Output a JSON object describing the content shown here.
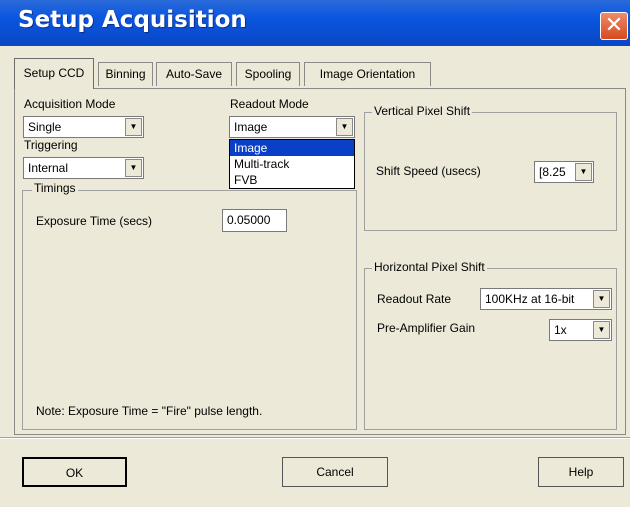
{
  "window": {
    "title": "Setup Acquisition",
    "close_glyph": "✕"
  },
  "tabs": [
    {
      "label": "Setup CCD",
      "active": true
    },
    {
      "label": "Binning"
    },
    {
      "label": "Auto-Save"
    },
    {
      "label": "Spooling"
    },
    {
      "label": "Image Orientation"
    }
  ],
  "setup_ccd": {
    "acquisition_mode": {
      "label": "Acquisition Mode",
      "value": "Single"
    },
    "readout_mode": {
      "label": "Readout Mode",
      "value": "Image",
      "options": [
        "Image",
        "Multi-track",
        "FVB"
      ],
      "selected_index": 0
    },
    "triggering": {
      "label": "Triggering",
      "value": "Internal"
    },
    "timings": {
      "title": "Timings",
      "exposure_label": "Exposure Time (secs)",
      "exposure_value": "0.05000",
      "note": "Note: Exposure Time = \"Fire\" pulse length."
    },
    "vertical_shift": {
      "title": "Vertical Pixel Shift",
      "speed_label": "Shift Speed (usecs)",
      "speed_value": "[8.25"
    },
    "horizontal_shift": {
      "title": "Horizontal Pixel Shift",
      "readout_rate_label": "Readout Rate",
      "readout_rate_value": "100KHz at 16-bit",
      "preamp_label": "Pre-Amplifier Gain",
      "preamp_value": "1x"
    }
  },
  "buttons": {
    "ok": "OK",
    "cancel": "Cancel",
    "help": "Help"
  },
  "icons": {
    "dropdown_arrow": "▼",
    "close": "close-icon"
  }
}
